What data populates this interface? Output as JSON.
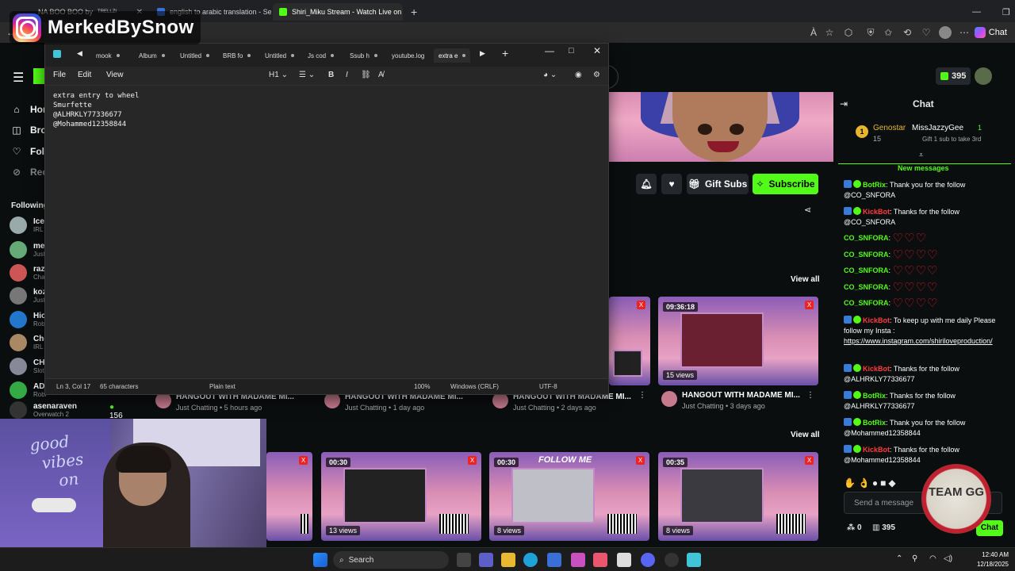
{
  "browser": {
    "tabs": [
      {
        "label": "NA BOO BOO by",
        "extra": "TRELLZI"
      },
      {
        "label": "english to arabic translation - Sear"
      },
      {
        "label": "Shiri_Miku Stream - Watch Live on"
      }
    ],
    "chat_label": "Chat",
    "reader_label": "À"
  },
  "overlay": {
    "instagram_name": "MerkedBySnow"
  },
  "notepad": {
    "tabs": [
      "mook",
      "Album",
      "Untitled",
      "BRB fo",
      "Untitled",
      "Js cod",
      "Ssub h",
      "youtube.log",
      "extra e"
    ],
    "menu": [
      "File",
      "Edit",
      "View"
    ],
    "heading": "H1",
    "content": "extra entry to wheel\nSmurfette\n@ALHRKLY77336677\n@Mohammed12358844",
    "status": {
      "position": "Ln 3, Col 17",
      "chars": "65 characters",
      "format": "Plain text",
      "zoom": "100%",
      "line_ending": "Windows (CRLF)",
      "encoding": "UTF-8"
    }
  },
  "kick": {
    "coins": "395",
    "nav": [
      "Hom",
      "Brow",
      "Foll",
      "Rec"
    ],
    "following_label": "Following",
    "following": [
      {
        "name": "Ice",
        "cat": "IRL"
      },
      {
        "name": "mes",
        "cat": "Just"
      },
      {
        "name": "razo",
        "cat": "Chat"
      },
      {
        "name": "koz",
        "cat": "Just"
      },
      {
        "name": "Hioh",
        "cat": "Robl"
      },
      {
        "name": "Cho",
        "cat": "IRL"
      },
      {
        "name": "CHU",
        "cat": "Slots"
      },
      {
        "name": "ADO",
        "cat": "Robl"
      },
      {
        "name": "asenaraven",
        "cat": "Overwatch 2",
        "viewers": "156"
      }
    ],
    "gift_subs": "Gift Subs",
    "subscribe": "Subscribe",
    "view_all": "View all",
    "row1_meta": [
      {
        "title": "HANGOUT WITH MADAME MI...",
        "sub": "Just Chatting • 5 hours ago"
      },
      {
        "title": "HANGOUT WITH MADAME MI...",
        "sub": "Just Chatting • 1 day ago"
      },
      {
        "title": "HANGOUT WITH MADAME MI...",
        "sub": "Just Chatting • 2 days ago"
      },
      {
        "title": "HANGOUT WITH MADAME MI...",
        "sub": "Just Chatting • 3 days ago"
      }
    ],
    "row1_thumb": {
      "duration": "09:36:18",
      "views": "15 views"
    },
    "row2": [
      {
        "duration": "00:30",
        "views": "13 views"
      },
      {
        "duration": "00:30",
        "views": "8 views",
        "caption": "FOLLOW ME"
      },
      {
        "duration": "00:35",
        "views": "8 views"
      }
    ]
  },
  "chat": {
    "title": "Chat",
    "top_gifter": {
      "name": "Genostar",
      "count": "15"
    },
    "second": {
      "name": "MissJazzyGee",
      "count": "1",
      "note": "Gift 1 sub to take 3rd"
    },
    "new_messages": "New messages",
    "messages": [
      {
        "user": "BotRix",
        "text": ": Thank you for the follow @CO_SNFORA",
        "color": "#53fc18"
      },
      {
        "user": "KickBot",
        "text": ": Thanks for the follow @CO_SNFORA",
        "color": "#ff3b3b"
      },
      {
        "user": "CO_SNFORA",
        "text": ":",
        "color": "#53fc18",
        "hearts": "♡♡♡"
      },
      {
        "user": "CO_SNFORA",
        "text": ":",
        "color": "#53fc18",
        "hearts": "♡♡♡♡"
      },
      {
        "user": "CO_SNFORA",
        "text": ":",
        "color": "#53fc18",
        "hearts": "♡♡♡♡"
      },
      {
        "user": "CO_SNFORA",
        "text": ":",
        "color": "#53fc18",
        "hearts": "♡♡♡♡"
      },
      {
        "user": "CO_SNFORA",
        "text": ":",
        "color": "#53fc18",
        "hearts": "♡♡♡♡"
      },
      {
        "user": "KickBot",
        "text": ": To keep up with me daily Please follow my Insta :",
        "link": "https://www.instagram.com/shiriloveproduction/",
        "color": "#ff3b3b"
      },
      {
        "user": "KickBot",
        "text": ": Thanks for the follow @ALHRKLY77336677",
        "color": "#ff3b3b"
      },
      {
        "user": "BotRix",
        "text": ": Thanks for the follow @ALHRKLY77336677",
        "color": "#53fc18"
      },
      {
        "user": "BotRix",
        "text": ": Thank you for the follow @Mohammed12358844",
        "color": "#53fc18"
      },
      {
        "user": "KickBot",
        "text": ": Thanks for the follow @Mohammed12358844",
        "color": "#ff3b3b"
      }
    ],
    "input_placeholder": "Send a message",
    "points": "0",
    "coins": "395",
    "send_label": "Chat"
  },
  "badge": {
    "text": "TEAM GG"
  },
  "webcam": {
    "sign": "good vibes on"
  },
  "taskbar": {
    "search": "Search",
    "time": "12:40 AM",
    "date": "12/18/2025"
  },
  "colors": {
    "kick_green": "#53fc18",
    "kickbot_red": "#ff3b3b"
  }
}
